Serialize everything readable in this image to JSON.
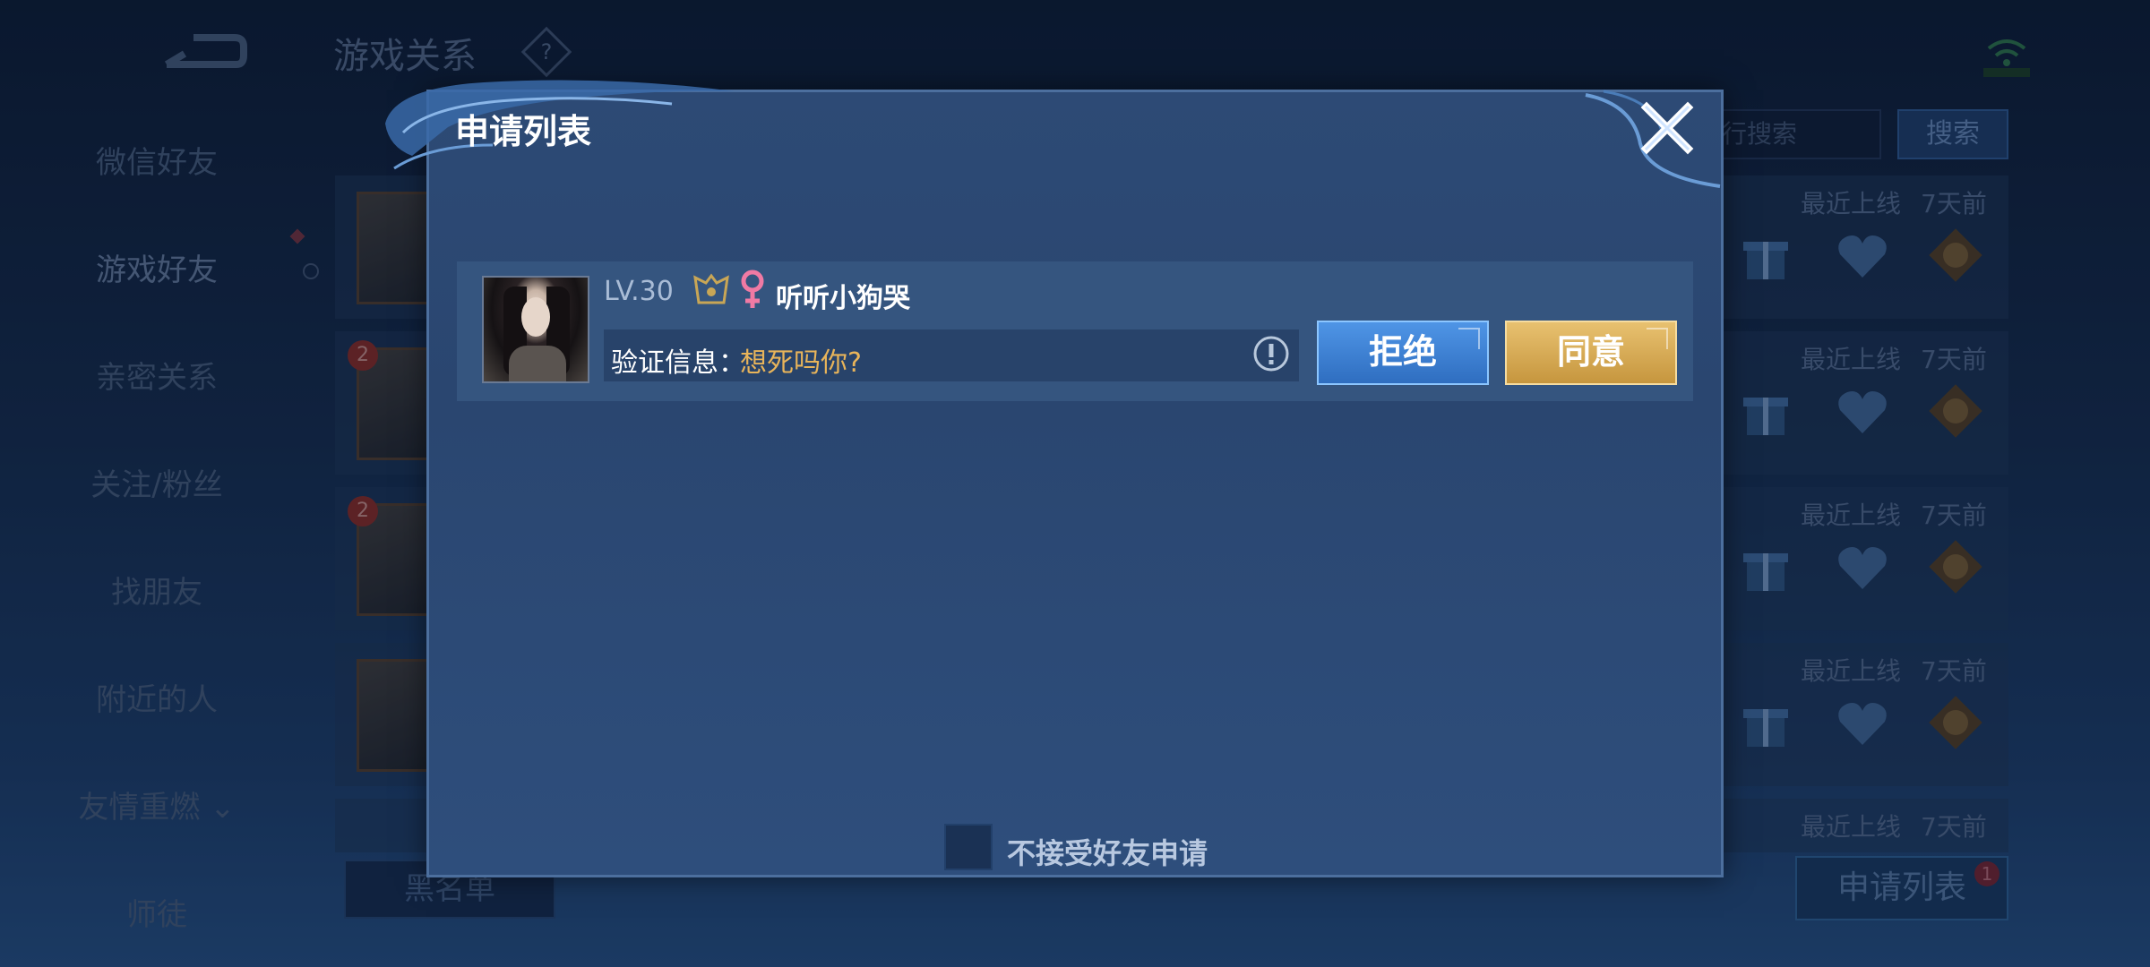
{
  "background": {
    "page_title": "游戏关系",
    "help_symbol": "?",
    "sidebar": {
      "items": [
        {
          "label": "微信好友"
        },
        {
          "label": "游戏好友"
        },
        {
          "label": "亲密关系"
        },
        {
          "label": "关注/粉丝"
        },
        {
          "label": "找朋友"
        },
        {
          "label": "附近的人"
        },
        {
          "label": "友情重燃 ⌄"
        },
        {
          "label": "师徒"
        }
      ]
    },
    "search": {
      "placeholder": "行搜索",
      "button_label": "搜索"
    },
    "friends": [
      {
        "last_online_label": "最近上线",
        "last_online_value": "7天前",
        "badge": ""
      },
      {
        "last_online_label": "最近上线",
        "last_online_value": "7天前",
        "badge": "2"
      },
      {
        "last_online_label": "最近上线",
        "last_online_value": "7天前",
        "badge": "2"
      },
      {
        "last_online_label": "最近上线",
        "last_online_value": "7天前",
        "badge": ""
      },
      {
        "last_online_label": "最近上线",
        "last_online_value": "7天前",
        "badge": ""
      }
    ],
    "blacklist_button": "黑名单",
    "request_list_button": "申请列表",
    "request_list_badge": "1"
  },
  "dialog": {
    "title": "申请列表",
    "request": {
      "level": "LV.30",
      "name": "听听小狗哭",
      "verify_label": "验证信息：",
      "verify_message": "想死吗你?",
      "reject_label": "拒绝",
      "accept_label": "同意"
    },
    "no_accept_label": "不接受好友申请",
    "icons": {
      "close": "close-icon",
      "rank": "rank-emblem-icon",
      "gender": "female-icon",
      "info": "info-icon"
    }
  },
  "colors": {
    "accent_gold": "#e8b45a",
    "reject_blue": "#3a80d6",
    "accept_gold": "#d8aa52",
    "dialog_bg": "#2d4a75",
    "female_pink": "#e8709a"
  }
}
